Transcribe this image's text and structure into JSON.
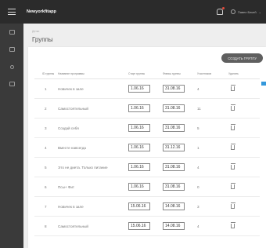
{
  "app": {
    "brand": "Newyorkfitapp"
  },
  "topbar": {
    "user_name": "Павел Бекей",
    "caret": "⌄"
  },
  "sidebar": {
    "items": [
      "groups-icon",
      "calendar-icon",
      "person-icon",
      "list-icon"
    ]
  },
  "breadcrumb": "Детки",
  "page": {
    "title": "Группы",
    "create_button": "СОЗДАТЬ ГРУППУ"
  },
  "table": {
    "headers": [
      "ID группы",
      "Название программы",
      "Старт группы",
      "Финиш группы",
      "Участников",
      "Удалить"
    ],
    "rows": [
      {
        "id": "1",
        "name": "Новичек в зале",
        "start": "1.06.16",
        "finish": "31.08.16",
        "members": "4"
      },
      {
        "id": "2",
        "name": "Самостоятельный",
        "start": "1.06.16",
        "finish": "31.08.16",
        "members": "11"
      },
      {
        "id": "3",
        "name": "Создай себя",
        "start": "1.06.16",
        "finish": "31.08.16",
        "members": "5"
      },
      {
        "id": "4",
        "name": "Вместе навсегда",
        "start": "1.06.16",
        "finish": "31.12.16",
        "members": "1"
      },
      {
        "id": "5",
        "name": "Это не диета. Только питание",
        "start": "1.06.16",
        "finish": "31.08.16",
        "members": "4"
      },
      {
        "id": "6",
        "name": "Псы+ Фит",
        "start": "1.06.16",
        "finish": "31.08.16",
        "members": "0"
      },
      {
        "id": "7",
        "name": "Новичек в зале",
        "start": "15.06.16",
        "finish": "14.08.16",
        "members": "3"
      },
      {
        "id": "8",
        "name": "Самостоятельный",
        "start": "15.06.16",
        "finish": "14.08.16",
        "members": "4"
      }
    ]
  }
}
